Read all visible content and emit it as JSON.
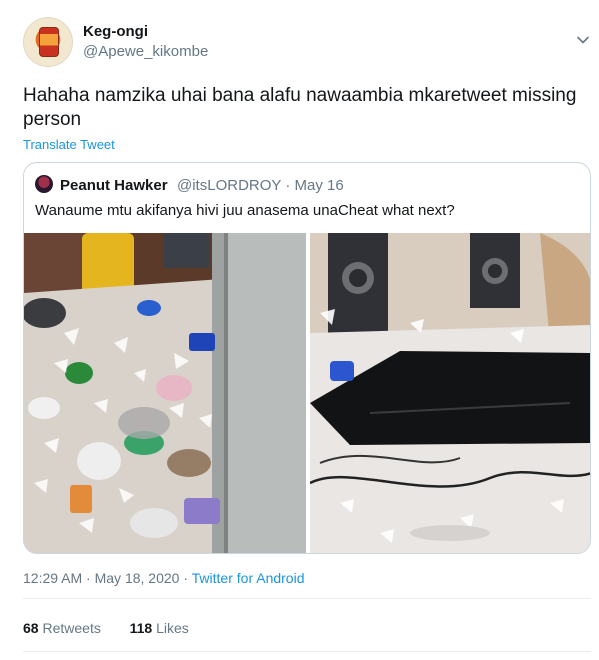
{
  "author": {
    "name": "Keg-ongi",
    "handle": "@Apewe_kikombe",
    "avatar_icon": "jar-avatar-icon"
  },
  "tweet": {
    "text": "Hahaha namzika uhai bana alafu nawaambia  mkaretweet missing person",
    "translate_label": "Translate Tweet",
    "time": "12:29 AM",
    "date": "May 18, 2020",
    "separator": "·",
    "via": "Twitter for Android"
  },
  "quoted": {
    "name": "Peanut Hawker",
    "handle": "@itsLORDROY",
    "separator": "·",
    "date": "May 16",
    "text": "Wanaume mtu akifanya hivi juu anasema unaCheat what next?"
  },
  "stats": {
    "retweets_count": "68",
    "retweets_label": "Retweets",
    "likes_count": "118",
    "likes_label": "Likes"
  },
  "colors": {
    "link": "#1b95e0",
    "secondary_text": "#657786",
    "border": "#ccd6dd"
  }
}
